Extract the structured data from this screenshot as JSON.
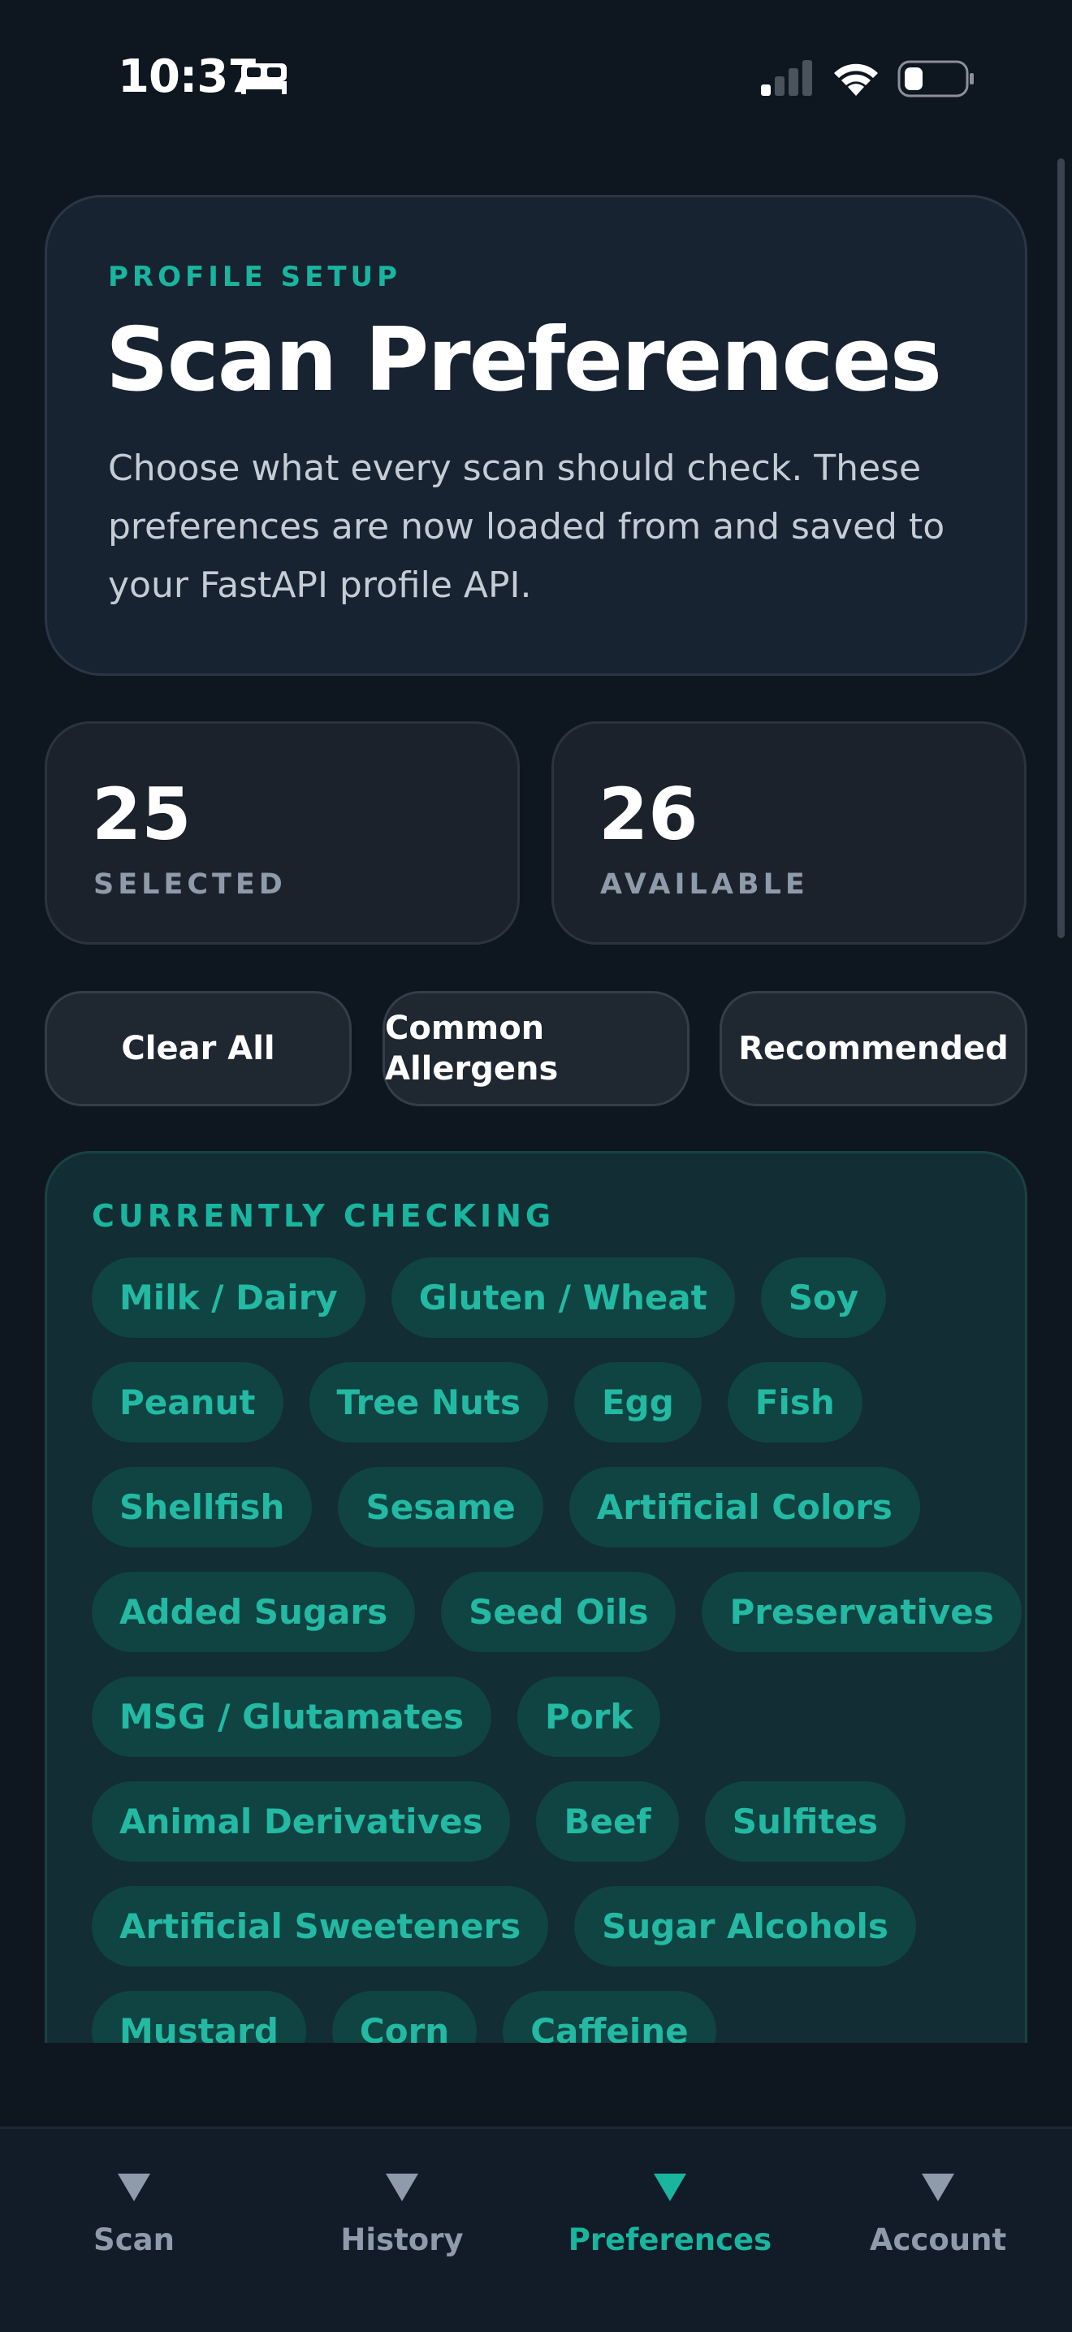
{
  "status_bar": {
    "time": "10:37"
  },
  "hero": {
    "eyebrow": "PROFILE SETUP",
    "title": "Scan Preferences",
    "description": "Choose what every scan should check. These preferences are now loaded from and saved to your FastAPI profile API."
  },
  "stats": {
    "selected_value": "25",
    "selected_label": "SELECTED",
    "available_value": "26",
    "available_label": "AVAILABLE"
  },
  "actions": {
    "clear_all": "Clear All",
    "common_allergens_line1": "Common",
    "common_allergens_line2": "Allergens",
    "recommended": "Recommended"
  },
  "checking": {
    "title": "CURRENTLY CHECKING",
    "rows": [
      [
        "Milk / Dairy",
        "Gluten / Wheat",
        "Soy"
      ],
      [
        "Peanut",
        "Tree Nuts",
        "Egg",
        "Fish"
      ],
      [
        "Shellfish",
        "Sesame",
        "Artificial Colors"
      ],
      [
        "Added Sugars",
        "Seed Oils",
        "Preservatives"
      ],
      [
        "MSG / Glutamates",
        "Pork"
      ],
      [
        "Animal Derivatives",
        "Beef",
        "Sulfites"
      ],
      [
        "Artificial Sweeteners",
        "Sugar Alcohols"
      ],
      [
        "Mustard",
        "Corn",
        "Caffeine"
      ]
    ]
  },
  "tabs": [
    {
      "label": "Scan",
      "active": false
    },
    {
      "label": "History",
      "active": false
    },
    {
      "label": "Preferences",
      "active": true
    },
    {
      "label": "Account",
      "active": false
    }
  ],
  "colors": {
    "accent": "#19b59e",
    "background": "#0e1620",
    "chip_bg": "#0f4443"
  }
}
